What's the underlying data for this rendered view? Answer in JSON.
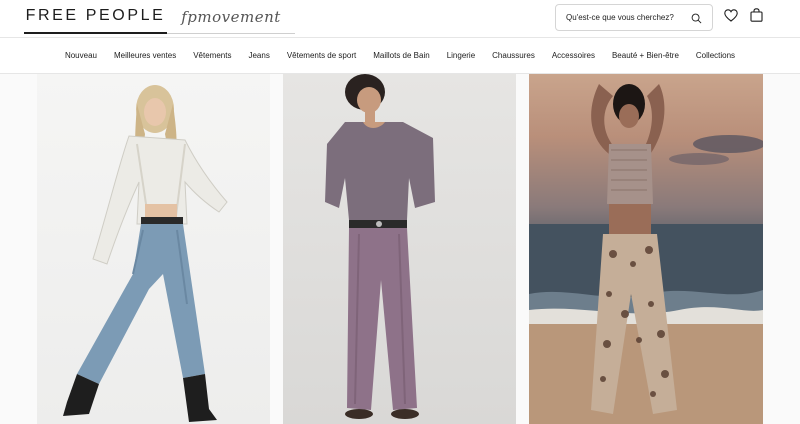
{
  "header": {
    "logo": "FREE PEOPLE",
    "sub_brand": "fpmovement",
    "search": {
      "placeholder": "Qu'est-ce que vous cherchez?"
    }
  },
  "nav": {
    "items": [
      "Nouveau",
      "Meilleures ventes",
      "Vêtements",
      "Jeans",
      "Vêtements de sport",
      "Maillots de Bain",
      "Lingerie",
      "Chaussures",
      "Accessoires",
      "Beauté + Bien-être",
      "Collections"
    ]
  },
  "products": [
    {
      "image_desc": "model-lace-cardigan-wide-jeans"
    },
    {
      "image_desc": "model-purple-tee-purple-pants"
    },
    {
      "image_desc": "model-beach-sunset-leopard-pants"
    }
  ],
  "colors": {
    "text": "#1d1d1d",
    "border": "#e6e6e6"
  }
}
